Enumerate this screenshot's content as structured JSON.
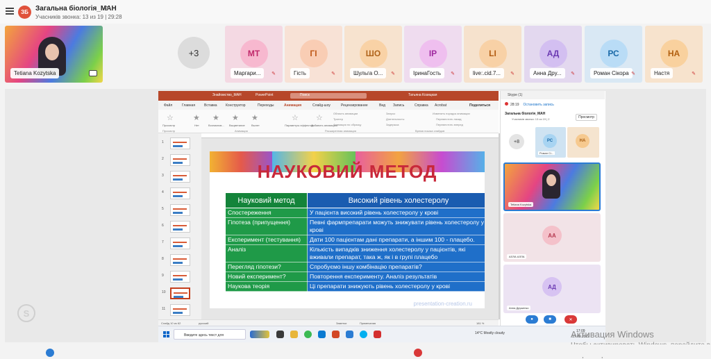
{
  "header": {
    "chat_avatar": "ЗБ",
    "chat_title": "Загальна біологія_МАН",
    "subtitle": "Учасників звонка: 13 из 19 | 29:28"
  },
  "participants": {
    "self_name": "Tetiana Kozytska",
    "more_count": "+3",
    "tiles": [
      {
        "initials": "МТ",
        "name": "Маргари...",
        "bg": "#f4d9e3",
        "av": "#f7b8cf",
        "fg": "#c0296b"
      },
      {
        "initials": "ГІ",
        "name": "Гість",
        "bg": "#f8e2d6",
        "av": "#f9cdb4",
        "fg": "#c05a1a"
      },
      {
        "initials": "ШО",
        "name": "Шульга О...",
        "bg": "#f7e3cf",
        "av": "#f9d2a6",
        "fg": "#b0631a"
      },
      {
        "initials": "ІР",
        "name": "ІринаГость",
        "bg": "#efdcef",
        "av": "#efbfef",
        "fg": "#a02aa0"
      },
      {
        "initials": "LI",
        "name": "live:.cid.7...",
        "bg": "#f6e2cd",
        "av": "#f8d1a6",
        "fg": "#b25c12"
      },
      {
        "initials": "АД",
        "name": "Анна Дру...",
        "bg": "#e3d8ef",
        "av": "#d3bff1",
        "fg": "#6b3ab2"
      },
      {
        "initials": "РС",
        "name": "Роман Сікора",
        "bg": "#d9e8f4",
        "av": "#b9dcf6",
        "fg": "#1a6aa8"
      },
      {
        "initials": "НА",
        "name": "Настя",
        "bg": "#f7e3cd",
        "av": "#f9d19e",
        "fg": "#b26010"
      }
    ]
  },
  "ppt": {
    "title_file": "Знайомство_МАН",
    "title_app": "PowerPoint",
    "search": "Поиск",
    "user": "Татьяна Козицкая",
    "tabs": [
      "Файл",
      "Главная",
      "Вставка",
      "Конструктор",
      "Переходы",
      "Анимация",
      "Слайд-шоу",
      "Рецензирование",
      "Вид",
      "Запись",
      "Справка",
      "Acrobat",
      "Поделиться"
    ],
    "ribbon": {
      "preview": "Просмотр",
      "preview_group": "Просмотр",
      "effects": [
        "Нет",
        "Возникнов...",
        "Выцветание",
        "Вылет"
      ],
      "animation_group": "Анимация",
      "effect_params": "Параметры эффектов",
      "add_anim": "Добавить анимацию",
      "anim_pane": "Область анимации",
      "trigger": "Триггер",
      "painter": "Анимация по образцу",
      "adv_group": "Расширенная анимация",
      "start": "Запуск:",
      "duration": "Длительность:",
      "delay": "Задержка:",
      "reorder": "Изменить порядок анимации",
      "earlier": "Переместить назад",
      "later": "Переместить вперед",
      "timing_group": "Время показа слайдов"
    },
    "thumb_nums": [
      "1",
      "2",
      "3",
      "4",
      "5",
      "6",
      "7",
      "8",
      "9",
      "10",
      "11"
    ],
    "status": {
      "slide": "Слайд 10 из 62",
      "lang": "русский",
      "size": "Размер: 3840 × 2160",
      "scale": "Масштаб: 100%",
      "selection": "Выделение: 2171 x 1232",
      "notes": "Заметки",
      "comments": "Примечания",
      "zoom": "181 %",
      "pages": "3 / 3"
    }
  },
  "slide": {
    "title": "НАУКОВИЙ МЕТОД",
    "col1_header": "Науковий метод",
    "col2_header": "Високий рівень холестеролу",
    "rows": [
      {
        "step": "Спостереження",
        "desc": "У пацієнта високий рівень холестеролу у крові"
      },
      {
        "step": "Гіпотеза (припущення)",
        "desc": "Певні фармпрепарати можуть знижувати рівень холестеролу у крові"
      },
      {
        "step": "Експеримент (тестування)",
        "desc": "Дати 100 пацієнтам дані препарати, а іншим 100 - плацебо."
      },
      {
        "step": "Аналіз",
        "desc": "Кількість випадків зниження холестеролу у пацієнтів, які вживали препарат, така ж, як і в групі плацебо"
      },
      {
        "step": "Перегляд гіпотези?",
        "desc": "Спробуємо іншу комбінацію препаратів?"
      },
      {
        "step": "Новий експеримент?",
        "desc": "Повторення експерименту. Аналіз результатів"
      },
      {
        "step": "Наукова теорія",
        "desc": "Ці препарати знижують рівень холестеролу у крові"
      }
    ],
    "watermark": "presentation-creation.ru"
  },
  "skype_panel": {
    "head": "Skype (1)",
    "timer": "28:19",
    "stop_rec": "Остановить запись",
    "chat": "Загальна біологія_МАН",
    "sub": "Учасників звонка: 13 из 19 | 2",
    "view": "Просмотр",
    "more": "+8",
    "rs_name": "Роман Сі...",
    "na": "НА",
    "rs": "РС",
    "big_name": "Tetiana Kozytska",
    "aa": "АА",
    "aa_name": "АЛЛА АЛЛА",
    "ad": "АД",
    "ad_name": "Анна Друженко"
  },
  "windows_taskbar": {
    "search": "Введите здесь текст для",
    "weather": "14°C  Mostly cloudy",
    "time": "17:09",
    "date": "17.09.2022"
  },
  "activation": {
    "line1": "Активация Windows",
    "line2": "Чтобы активировать Windows, перейдите в",
    "line3": "\"Параметры\"."
  },
  "colors": {
    "ppt_red": "#b7472a",
    "green": "#1f9a48",
    "blue": "#1f6fc9",
    "title_red": "#c8283a"
  }
}
